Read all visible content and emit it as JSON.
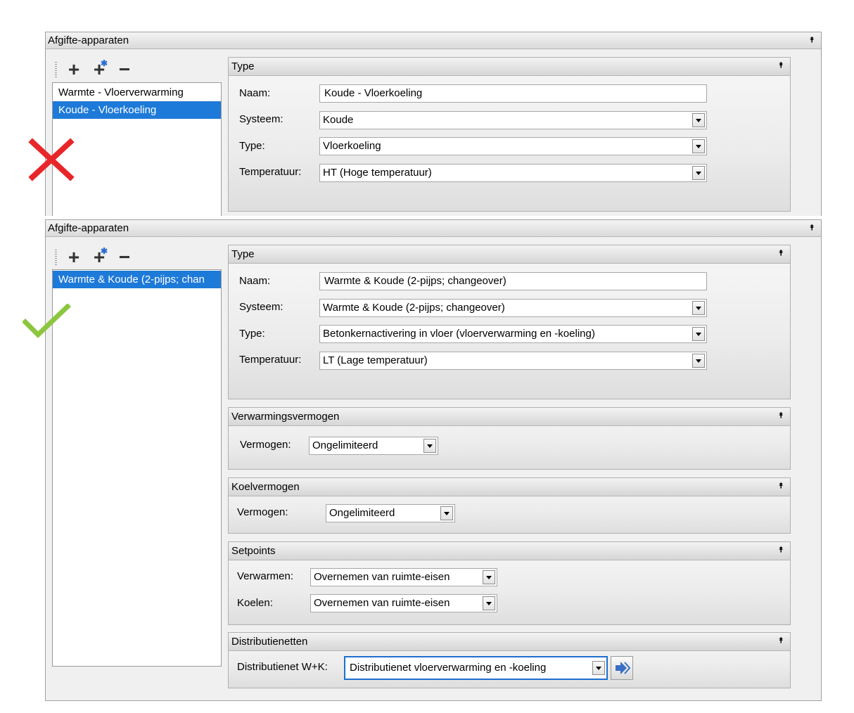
{
  "colors": {
    "accent": "#1e7ad8",
    "cross": "#e8262a",
    "check": "#8cc63f"
  },
  "top": {
    "panel_title": "Afgifte-apparaten",
    "list": [
      "Warmte - Vloerverwarming",
      "Koude - Vloerkoeling"
    ],
    "selected_index": 1,
    "type_group": {
      "title": "Type",
      "naam_label": "Naam:",
      "naam_value": "Koude - Vloerkoeling",
      "systeem_label": "Systeem:",
      "systeem_value": "Koude",
      "type_label": "Type:",
      "type_value": "Vloerkoeling",
      "temp_label": "Temperatuur:",
      "temp_value": "HT (Hoge temperatuur)"
    }
  },
  "bottom": {
    "panel_title": "Afgifte-apparaten",
    "list": [
      "Warmte & Koude (2-pijps; chan"
    ],
    "selected_index": 0,
    "type_group": {
      "title": "Type",
      "naam_label": "Naam:",
      "naam_value": "Warmte & Koude (2-pijps; changeover)",
      "systeem_label": "Systeem:",
      "systeem_value": "Warmte & Koude (2-pijps; changeover)",
      "type_label": "Type:",
      "type_value": "Betonkernactivering in vloer (vloerverwarming en -koeling)",
      "temp_label": "Temperatuur:",
      "temp_value": "LT (Lage temperatuur)"
    },
    "verwarming": {
      "title": "Verwarmingsvermogen",
      "label": "Vermogen:",
      "value": "Ongelimiteerd"
    },
    "koel": {
      "title": "Koelvermogen",
      "label": "Vermogen:",
      "value": "Ongelimiteerd"
    },
    "setpoints": {
      "title": "Setpoints",
      "verwarmen_label": "Verwarmen:",
      "verwarmen_value": "Overnemen van ruimte-eisen",
      "koelen_label": "Koelen:",
      "koelen_value": "Overnemen van ruimte-eisen"
    },
    "distributie": {
      "title": "Distributienetten",
      "label": "Distributienet W+K:",
      "value": "Distributienet vloerverwarming en -koeling"
    }
  }
}
